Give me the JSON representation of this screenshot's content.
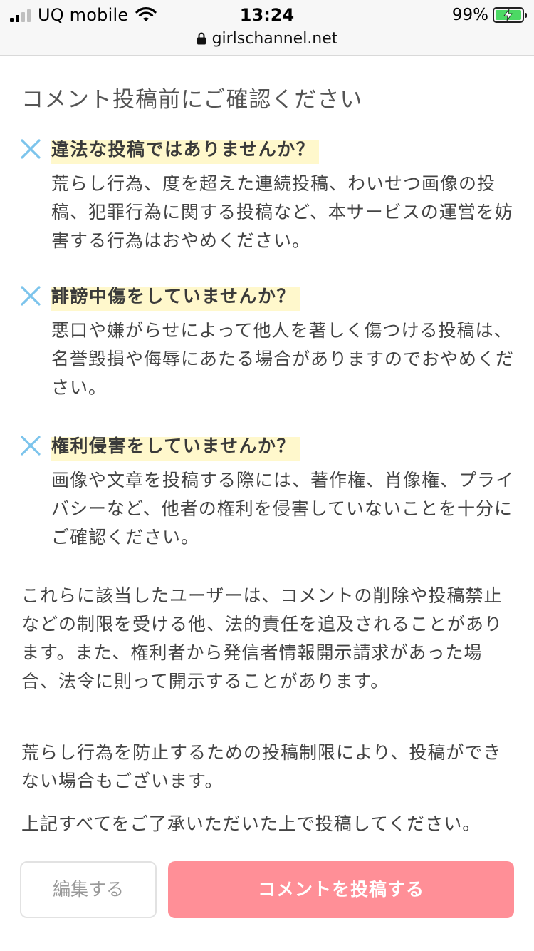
{
  "status_bar": {
    "carrier": "UQ mobile",
    "time": "13:24",
    "battery_percent": "99%",
    "battery_level": 0.99,
    "url": "girlschannel.net",
    "colors": {
      "battery": "#4cd964"
    }
  },
  "page": {
    "heading": "コメント投稿前にご確認ください",
    "rules": [
      {
        "icon": "cross-icon",
        "title": "違法な投稿ではありませんか？",
        "body": "荒らし行為、度を超えた連続投稿、わいせつ画像の投稿、犯罪行為に関する投稿など、本サービスの運営を妨害する行為はおやめください。"
      },
      {
        "icon": "cross-icon",
        "title": "誹謗中傷をしていませんか？",
        "body": "悪口や嫌がらせによって他人を著しく傷つける投稿は、名誉毀損や侮辱にあたる場合がありますのでおやめください。"
      },
      {
        "icon": "cross-icon",
        "title": "権利侵害をしていませんか？",
        "body": "画像や文章を投稿する際には、著作権、肖像権、プライバシーなど、他者の権利を侵害していないことを十分にご確認ください。"
      }
    ],
    "paragraphs": [
      "これらに該当したユーザーは、コメントの削除や投稿禁止などの制限を受ける他、法的責任を追及されることがあります。また、権利者から発信者情報開示請求があった場合、法令に則って開示することがあります。",
      "荒らし行為を防止するための投稿制限により、投稿ができない場合もございます。",
      "上記すべてをご了承いただいた上で投稿してください。"
    ],
    "buttons": {
      "edit_label": "編集する",
      "post_label": "コメントを投稿する"
    },
    "colors": {
      "cross": "#7cc4ec",
      "highlight": "#fff8cc",
      "post_button": "#ff8f97"
    }
  }
}
